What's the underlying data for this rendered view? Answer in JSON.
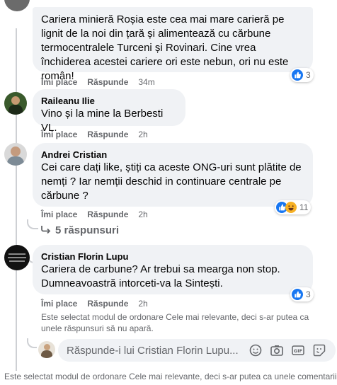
{
  "comments": [
    {
      "author": "",
      "text": "Cariera minieră Roșia este cea mai mare carieră pe lignit de la noi din țară și alimentează cu cărbune termocentralele Turceni și Rovinari. Cine vrea închiderea acestei cariere ori este nebun, ori nu este român!",
      "like_label": "Îmi place",
      "reply_label": "Răspunde",
      "time": "34m",
      "reaction_count": "3"
    },
    {
      "author": "Raileanu Ilie",
      "text": "Vino și la mine la Berbesti VL.",
      "like_label": "Îmi place",
      "reply_label": "Răspunde",
      "time": "2h"
    },
    {
      "author": "Andrei Cristian",
      "text": "Cei care dați like, știți ca aceste ONG-uri sunt plătite de nemți ? Iar nemții deschid in continuare centrale pe cărbune ?",
      "like_label": "Îmi place",
      "reply_label": "Răspunde",
      "time": "2h",
      "reaction_count": "11",
      "replies_label": "5 răspunsuri"
    },
    {
      "author": "Cristian Florin Lupu",
      "text": "Cariera de carbune? Ar trebui sa mearga non stop. Dumneavoastră intorceti-va la Sintești.",
      "like_label": "Îmi place",
      "reply_label": "Răspunde",
      "time": "2h",
      "reaction_count": "3"
    }
  ],
  "sort_note_inner": "Este selectat modul de ordonare Cele mai relevante, deci s-ar putea ca unele răspunsuri să nu apară.",
  "reply_placeholder": "Răspunde-i lui Cristian Florin Lupu...",
  "sort_note_outer": "Este selectat modul de ordonare Cele mai relevante, deci s-ar putea ca unele comentarii",
  "icons": {
    "like": "thumbs-up-icon",
    "haha": "haha-emoji-icon",
    "replies": "reply-arrow-icon",
    "emoji": "emoji-icon",
    "camera": "camera-icon",
    "gif": "gif-icon",
    "sticker": "sticker-icon"
  },
  "colors": {
    "like_blue": "#1877f2",
    "haha_yellow": "#f7b125",
    "bubble": "#f0f2f5",
    "muted": "#65676b"
  }
}
